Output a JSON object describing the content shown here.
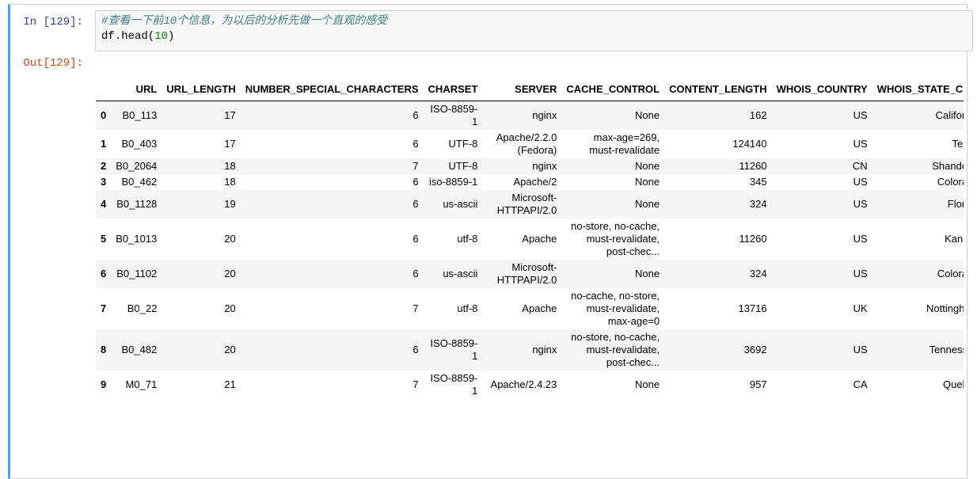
{
  "input_prompt": "In [129]:",
  "output_prompt": "Out[129]:",
  "code": {
    "comment": "#查看一下前10个信息，为以后的分析先做一个直观的感受",
    "line2_prefix": "df.head(",
    "line2_arg": "10",
    "line2_suffix": ")"
  },
  "table": {
    "headers": [
      "",
      "URL",
      "URL_LENGTH",
      "NUMBER_SPECIAL_CHARACTERS",
      "CHARSET",
      "SERVER",
      "CACHE_CONTROL",
      "CONTENT_LENGTH",
      "WHOIS_COUNTRY",
      "WHOIS_STATE_CITY"
    ],
    "rows": [
      {
        "idx": "0",
        "url": "B0_113",
        "url_length": "17",
        "special": "6",
        "charset": "ISO-8859-1",
        "server": "nginx",
        "cache": "None",
        "content_length": "162",
        "country": "US",
        "state": "California"
      },
      {
        "idx": "1",
        "url": "B0_403",
        "url_length": "17",
        "special": "6",
        "charset": "UTF-8",
        "server": "Apache/2.2.0 (Fedora)",
        "cache": "max-age=269, must-revalidate",
        "content_length": "124140",
        "country": "US",
        "state": "Texas"
      },
      {
        "idx": "2",
        "url": "B0_2064",
        "url_length": "18",
        "special": "7",
        "charset": "UTF-8",
        "server": "nginx",
        "cache": "None",
        "content_length": "11260",
        "country": "CN",
        "state": "Shandong"
      },
      {
        "idx": "3",
        "url": "B0_462",
        "url_length": "18",
        "special": "6",
        "charset": "iso-8859-1",
        "server": "Apache/2",
        "cache": "None",
        "content_length": "345",
        "country": "US",
        "state": "Colorado"
      },
      {
        "idx": "4",
        "url": "B0_1128",
        "url_length": "19",
        "special": "6",
        "charset": "us-ascii",
        "server": "Microsoft-HTTPAPI/2.0",
        "cache": "None",
        "content_length": "324",
        "country": "US",
        "state": "Florida"
      },
      {
        "idx": "5",
        "url": "B0_1013",
        "url_length": "20",
        "special": "6",
        "charset": "utf-8",
        "server": "Apache",
        "cache": "no-store, no-cache, must-revalidate, post-chec...",
        "content_length": "11260",
        "country": "US",
        "state": "Kansas"
      },
      {
        "idx": "6",
        "url": "B0_1102",
        "url_length": "20",
        "special": "6",
        "charset": "us-ascii",
        "server": "Microsoft-HTTPAPI/2.0",
        "cache": "None",
        "content_length": "324",
        "country": "US",
        "state": "Colorado"
      },
      {
        "idx": "7",
        "url": "B0_22",
        "url_length": "20",
        "special": "7",
        "charset": "utf-8",
        "server": "Apache",
        "cache": "no-cache, no-store, must-revalidate, max-age=0",
        "content_length": "13716",
        "country": "UK",
        "state": "Nottingham"
      },
      {
        "idx": "8",
        "url": "B0_482",
        "url_length": "20",
        "special": "6",
        "charset": "ISO-8859-1",
        "server": "nginx",
        "cache": "no-store, no-cache, must-revalidate, post-chec...",
        "content_length": "3692",
        "country": "US",
        "state": "Tennessee"
      },
      {
        "idx": "9",
        "url": "M0_71",
        "url_length": "21",
        "special": "7",
        "charset": "ISO-8859-1",
        "server": "Apache/2.4.23",
        "cache": "None",
        "content_length": "957",
        "country": "CA",
        "state": "Quebec"
      }
    ]
  }
}
